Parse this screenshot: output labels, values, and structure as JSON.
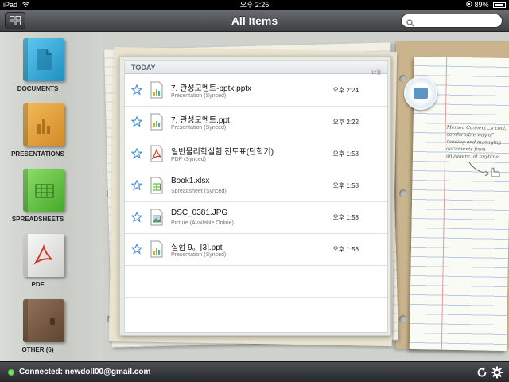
{
  "status_bar": {
    "device": "iPad",
    "time": "오후 2:25",
    "battery": "89%"
  },
  "nav": {
    "title": "All Items",
    "search_placeholder": ""
  },
  "sidebar": {
    "items": [
      {
        "label": "DOCUMENTS",
        "icon": "documents-icon",
        "color": "#3bb0d9"
      },
      {
        "label": "PRESENTATIONS",
        "icon": "presentations-icon",
        "color": "#e6a33c"
      },
      {
        "label": "SPREADSHEETS",
        "icon": "spreadsheets-icon",
        "color": "#6cc94a"
      },
      {
        "label": "PDF",
        "icon": "pdf-icon",
        "color": "#e9e9e6"
      },
      {
        "label": "OTHER (6)",
        "icon": "other-icon",
        "color": "#7b5d45"
      }
    ]
  },
  "list": {
    "section_title": "TODAY",
    "section_count": "12월",
    "files": [
      {
        "name": "7. 관성모멘트-pptx.pptx",
        "status": "Presentation (Synced)",
        "time": "오후 2:24",
        "type": "presentation"
      },
      {
        "name": "7. 관성모멘트.ppt",
        "status": "Presentation (Synced)",
        "time": "오후 2:22",
        "type": "presentation"
      },
      {
        "name": "일반물리학실험 진도표(단학기)",
        "status": "PDF (Synced)",
        "time": "오후 1:58",
        "type": "pdf"
      },
      {
        "name": "Book1.xlsx",
        "status": "Spreadsheet (Synced)",
        "time": "오후 1:58",
        "type": "spreadsheet"
      },
      {
        "name": "DSC_0381.JPG",
        "status": "Picture (Available Online)",
        "time": "오후 1:58",
        "type": "picture"
      },
      {
        "name": "실험 9。[3].ppt",
        "status": "Presentation (Synced)",
        "time": "오후 1:56",
        "type": "presentation"
      }
    ]
  },
  "note": {
    "text": "Memeo Connect...a cool, comfortable way of reading and managing documents from anywhere, at anytime"
  },
  "toolbar": {
    "connection": "Connected: newdoll00@gmail.com"
  },
  "colors": {
    "accent_green": "#2fa81e",
    "star_blue": "#4a90d9",
    "pdf_red": "#d33a2c"
  }
}
